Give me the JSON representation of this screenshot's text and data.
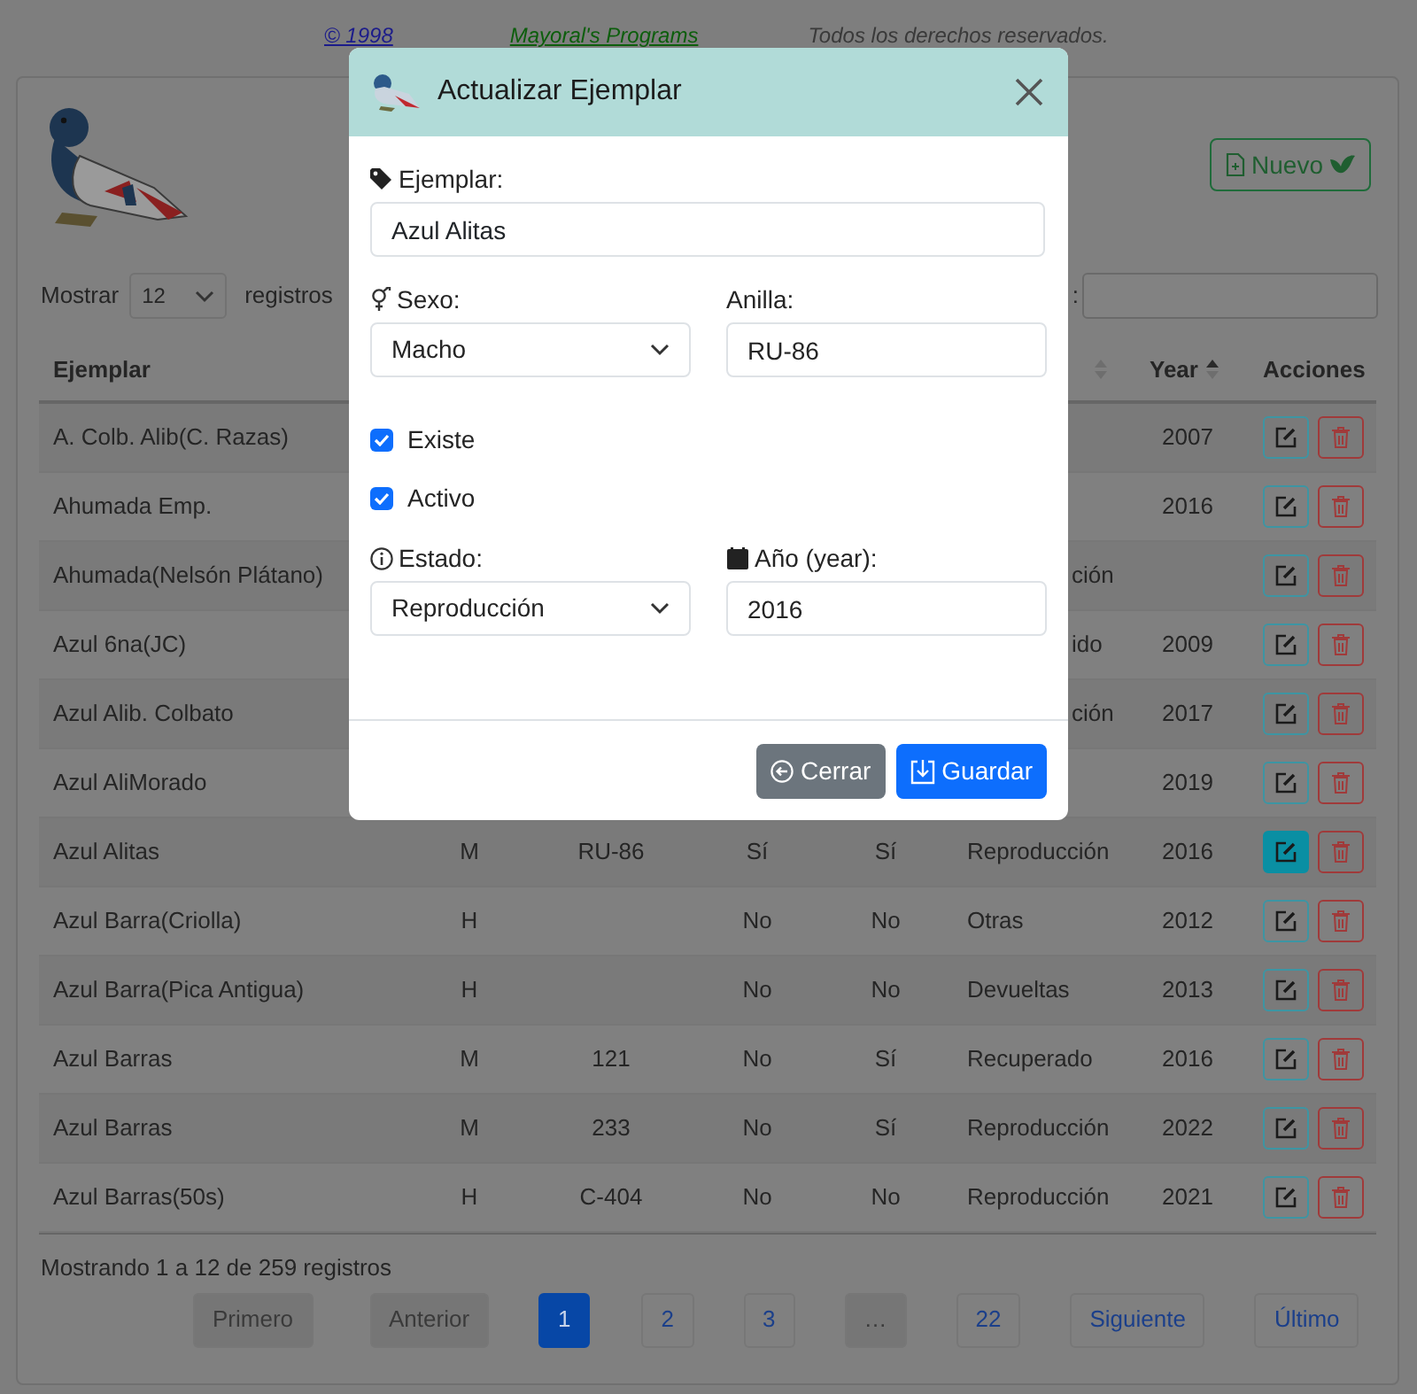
{
  "credits": [
    {
      "text": "© 1998",
      "color": "#1c1c8a"
    },
    {
      "text": "Mayoral's Programs",
      "color": "#0d5e0d"
    },
    {
      "text": "Todos los derechos reservados.",
      "color": "#3a3a3a"
    }
  ],
  "new_button": {
    "label": "Nuevo"
  },
  "length_menu": {
    "before": "Mostrar",
    "value": "12",
    "after": "registros"
  },
  "search": {
    "label": ":"
  },
  "columns": {
    "ejemplar": {
      "label": "Ejemplar"
    },
    "estado": {
      "sorted": false
    },
    "year": {
      "label": "Year",
      "sorted": true
    },
    "acciones": {
      "label": "Acciones"
    }
  },
  "rows": [
    {
      "ejemplar": "A. Colb. Alib(C. Razas)",
      "year": "2007",
      "editing": false
    },
    {
      "ejemplar": "Ahumada Emp.",
      "year": "2016",
      "editing": false
    },
    {
      "ejemplar": "Ahumada(Nelsón Plátano)",
      "estado_fragment": "ción",
      "editing": false
    },
    {
      "ejemplar": "Azul 6na(JC)",
      "estado_fragment": "ido",
      "year": "2009",
      "editing": false
    },
    {
      "ejemplar": "Azul Alib. Colbato",
      "estado_fragment": "ción",
      "year": "2017",
      "editing": false
    },
    {
      "ejemplar": "Azul AliMorado",
      "year": "2019",
      "editing": false
    },
    {
      "ejemplar": "Azul Alitas",
      "sexo": "M",
      "anilla": "RU-86",
      "existe": "Sí",
      "activo": "Sí",
      "estado": "Reproducción",
      "year": "2016",
      "editing": true
    },
    {
      "ejemplar": "Azul Barra(Criolla)",
      "sexo": "H",
      "existe": "No",
      "activo": "No",
      "estado": "Otras",
      "year": "2012",
      "editing": false
    },
    {
      "ejemplar": "Azul Barra(Pica Antigua)",
      "sexo": "H",
      "existe": "No",
      "activo": "No",
      "estado": "Devueltas",
      "year": "2013",
      "editing": false
    },
    {
      "ejemplar": "Azul Barras",
      "sexo": "M",
      "anilla": "121",
      "existe": "No",
      "activo": "Sí",
      "estado": "Recuperado",
      "year": "2016",
      "editing": false
    },
    {
      "ejemplar": "Azul Barras",
      "sexo": "M",
      "anilla": "233",
      "existe": "No",
      "activo": "Sí",
      "estado": "Reproducción",
      "year": "2022",
      "editing": false
    },
    {
      "ejemplar": "Azul Barras(50s)",
      "sexo": "H",
      "anilla": "C-404",
      "existe": "No",
      "activo": "No",
      "estado": "Reproducción",
      "year": "2021",
      "editing": false
    }
  ],
  "info": "Mostrando 1 a 12 de 259 registros",
  "pagination": [
    {
      "label": "Primero",
      "selected": false,
      "disabled": true
    },
    {
      "label": "Anterior",
      "selected": false,
      "disabled": true
    },
    {
      "label": "1",
      "selected": true,
      "disabled": false
    },
    {
      "label": "2",
      "selected": false,
      "disabled": false
    },
    {
      "label": "3",
      "selected": false,
      "disabled": false
    },
    {
      "label": "…",
      "selected": false,
      "disabled": true
    },
    {
      "label": "22",
      "selected": false,
      "disabled": false
    },
    {
      "label": "Siguiente",
      "selected": false,
      "disabled": false
    },
    {
      "label": "Último",
      "selected": false,
      "disabled": false
    }
  ],
  "modal": {
    "title": "Actualizar Ejemplar",
    "ejemplar": {
      "label": "Ejemplar:",
      "value": "Azul Alitas"
    },
    "sexo": {
      "label": "Sexo:",
      "value": "Macho"
    },
    "anilla": {
      "label": "Anilla:",
      "value": "RU-86"
    },
    "checks": [
      {
        "label": "Existe",
        "checked": true
      },
      {
        "label": "Activo",
        "checked": true
      }
    ],
    "estado": {
      "label": "Estado:",
      "value": "Reproducción"
    },
    "year": {
      "label": "Año (year):",
      "value": "2016"
    },
    "buttons": [
      {
        "label": "Cerrar",
        "kind": "secondary"
      },
      {
        "label": "Guardar",
        "kind": "primary"
      }
    ]
  }
}
